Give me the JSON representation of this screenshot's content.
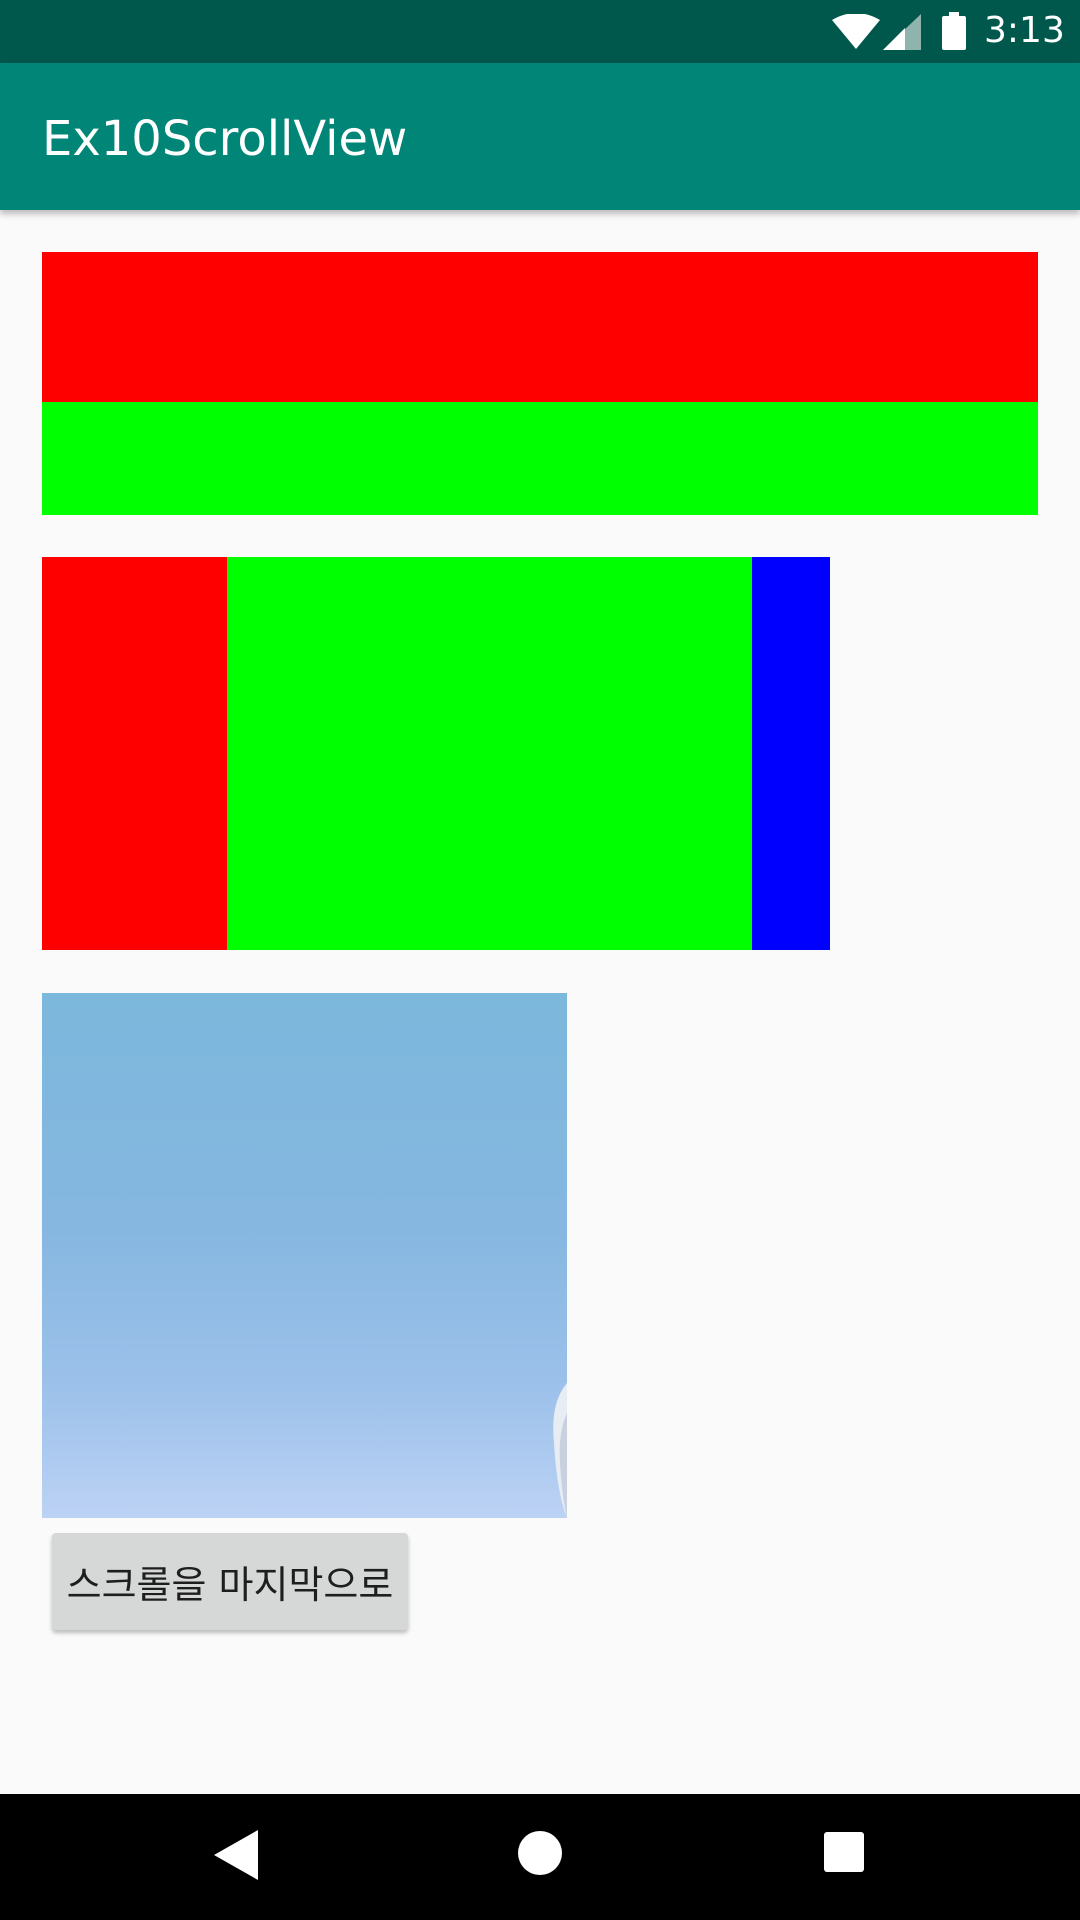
{
  "status_bar": {
    "time": "3:13",
    "icons": [
      "wifi-icon",
      "cell-signal-icon",
      "battery-icon"
    ],
    "background": "#00574b"
  },
  "app_bar": {
    "title": "Ex10ScrollView",
    "background": "#008577"
  },
  "vertical_layout": {
    "blocks": [
      {
        "name": "red",
        "color": "#ff0000"
      },
      {
        "name": "green",
        "color": "#00ff00"
      }
    ]
  },
  "horizontal_layout": {
    "blocks": [
      {
        "name": "red",
        "color": "#ff0000"
      },
      {
        "name": "green",
        "color": "#00ff00"
      },
      {
        "name": "blue",
        "color": "#0000ff"
      }
    ]
  },
  "image": {
    "description": "sky photo",
    "colors": [
      "#7cb7dc",
      "#bcd2f5"
    ]
  },
  "button": {
    "label": "스크롤을 마지막으로",
    "background": "#d6d7d7"
  },
  "nav_bar": {
    "buttons": [
      "back-icon",
      "home-icon",
      "recents-icon"
    ],
    "background": "#000000"
  }
}
